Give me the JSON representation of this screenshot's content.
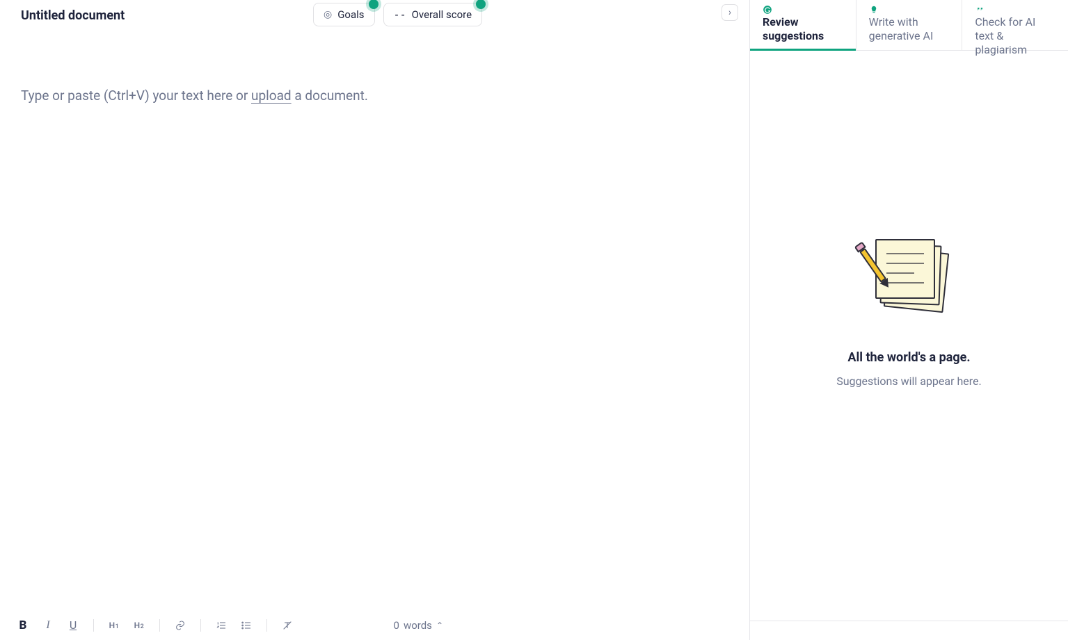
{
  "header": {
    "doc_title": "Untitled document",
    "goals_label": "Goals",
    "score_prefix": "--",
    "score_label": "Overall score"
  },
  "editor": {
    "placeholder_before": "Type or paste (Ctrl+V) your text here or ",
    "upload_label": "upload",
    "placeholder_after": " a document."
  },
  "bottombar": {
    "bold": "B",
    "italic": "I",
    "underline": "U",
    "h1": "H",
    "h1_sub": "1",
    "h2": "H",
    "h2_sub": "2",
    "word_count_value": "0",
    "word_count_label": "words"
  },
  "sidebar": {
    "tabs": [
      {
        "label": "Review suggestions"
      },
      {
        "label": "Write with generative AI"
      },
      {
        "label": "Check for AI text & plagiarism"
      }
    ],
    "empty_title": "All the world's a page.",
    "empty_sub": "Suggestions will appear here."
  }
}
